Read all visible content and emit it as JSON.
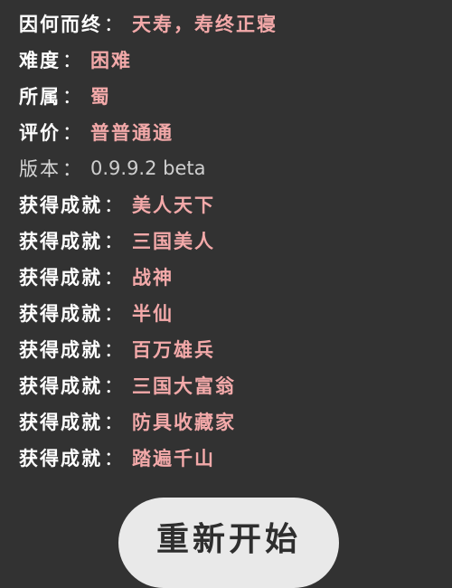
{
  "stats": [
    {
      "label": "因何而终",
      "colon": "：",
      "value": "天寿，寿终正寝"
    },
    {
      "label": "难度",
      "colon": "：",
      "value": "困难"
    },
    {
      "label": "所属",
      "colon": "：",
      "value": "蜀"
    },
    {
      "label": "评价",
      "colon": "：",
      "value": "普普通通"
    },
    {
      "label": "版本",
      "colon": "：",
      "value": "0.9.9.2 beta"
    },
    {
      "label": "获得成就",
      "colon": "：",
      "value": "美人天下"
    },
    {
      "label": "获得成就",
      "colon": "：",
      "value": "三国美人"
    },
    {
      "label": "获得成就",
      "colon": "：",
      "value": "战神"
    },
    {
      "label": "获得成就",
      "colon": "：",
      "value": "半仙"
    },
    {
      "label": "获得成就",
      "colon": "：",
      "value": "百万雄兵"
    },
    {
      "label": "获得成就",
      "colon": "：",
      "value": "三国大富翁"
    },
    {
      "label": "获得成就",
      "colon": "：",
      "value": "防具收藏家"
    },
    {
      "label": "获得成就",
      "colon": "：",
      "value": "踏遍千山"
    }
  ],
  "restart_button": {
    "label": "重新开始"
  },
  "colors": {
    "background": "#323232",
    "label": "#ffffff",
    "value": "#f3a9a9",
    "version_text": "#cfcfcf",
    "button_bg": "#e9e9e9"
  }
}
